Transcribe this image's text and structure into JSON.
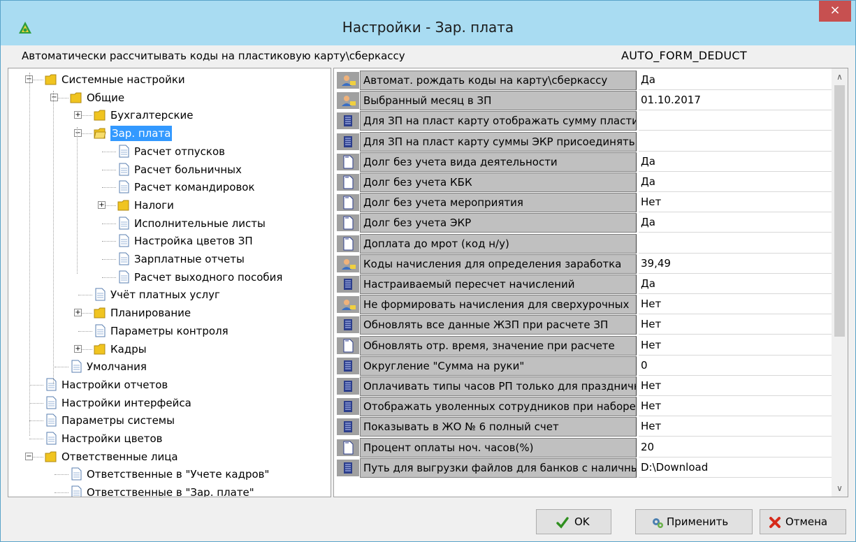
{
  "window": {
    "title": "Настройки - Зар. плата",
    "close": "×"
  },
  "description": {
    "text": "Автоматически рассчитывать коды на пластиковую карту\\сберкассу",
    "code": "AUTO_FORM_DEDUCT"
  },
  "tree": [
    {
      "label": "Системные настройки",
      "icon": "folder-icon"
    },
    {
      "label": "Общие",
      "icon": "folder-icon"
    },
    {
      "label": "Бухгалтерские",
      "icon": "folder-icon"
    },
    {
      "label": "Зар. плата",
      "icon": "folder-open-icon",
      "selected": true
    },
    {
      "label": "Расчет отпусков",
      "icon": "document-icon"
    },
    {
      "label": "Расчет больничных",
      "icon": "document-icon"
    },
    {
      "label": "Расчет командировок",
      "icon": "document-icon"
    },
    {
      "label": "Налоги",
      "icon": "folder-icon"
    },
    {
      "label": "Исполнительные листы",
      "icon": "document-icon"
    },
    {
      "label": "Настройка цветов ЗП",
      "icon": "document-icon"
    },
    {
      "label": "Зарплатные отчеты",
      "icon": "document-icon"
    },
    {
      "label": "Расчет выходного пособия",
      "icon": "document-icon"
    },
    {
      "label": "Учёт платных услуг",
      "icon": "document-icon"
    },
    {
      "label": "Планирование",
      "icon": "folder-icon"
    },
    {
      "label": "Параметры контроля",
      "icon": "document-icon"
    },
    {
      "label": "Кадры",
      "icon": "folder-icon"
    },
    {
      "label": "Умолчания",
      "icon": "document-icon"
    },
    {
      "label": "Настройки отчетов",
      "icon": "document-icon"
    },
    {
      "label": "Настройки интерфейса",
      "icon": "document-icon"
    },
    {
      "label": "Параметры системы",
      "icon": "document-icon"
    },
    {
      "label": "Настройки цветов",
      "icon": "document-icon"
    },
    {
      "label": "Ответственные лица",
      "icon": "folder-icon"
    },
    {
      "label": "Ответственные в \"Учете кадров\"",
      "icon": "document-icon"
    },
    {
      "label": "Ответственные в \"Зар. плате\"",
      "icon": "document-icon"
    }
  ],
  "settings": [
    {
      "icon": "user-icon",
      "name": "Автомат. рождать коды на карту\\сберкассу",
      "value": "Да"
    },
    {
      "icon": "user-icon",
      "name": "Выбранный месяц в ЗП",
      "value": "01.10.2017"
    },
    {
      "icon": "database-icon",
      "name": "Для ЗП на пласт карту отображать сумму пластиковой",
      "value": ""
    },
    {
      "icon": "database-icon",
      "name": "Для ЗП на пласт карту суммы ЭКР присоединять",
      "value": ""
    },
    {
      "icon": "page-icon",
      "name": "Долг без учета вида деятельности",
      "value": "Да"
    },
    {
      "icon": "page-icon",
      "name": "Долг без учета КБК",
      "value": "Да"
    },
    {
      "icon": "page-icon",
      "name": "Долг без учета мероприятия",
      "value": "Нет"
    },
    {
      "icon": "page-icon",
      "name": "Долг без учета ЭКР",
      "value": "Да"
    },
    {
      "icon": "page-icon",
      "name": "Доплата до мрот (код н/у)",
      "value": ""
    },
    {
      "icon": "user-icon",
      "name": "Коды начисления для определения заработка",
      "value": "39,49"
    },
    {
      "icon": "database-icon",
      "name": "Настраиваемый пересчет начислений",
      "value": "Да"
    },
    {
      "icon": "user-icon",
      "name": "Не формировать начисления для сверхурочных",
      "value": "Нет"
    },
    {
      "icon": "database-icon",
      "name": "Обновлять все данные ЖЗП при расчете ЗП",
      "value": "Нет"
    },
    {
      "icon": "page-icon",
      "name": "Обновлять отр. время, значение при расчете",
      "value": "Нет"
    },
    {
      "icon": "database-icon",
      "name": "Округление \"Сумма на руки\"",
      "value": "0"
    },
    {
      "icon": "database-icon",
      "name": "Оплачивать типы часов РП только для праздничных",
      "value": "Нет"
    },
    {
      "icon": "database-icon",
      "name": "Отображать уволенных сотрудников при наборе",
      "value": "Нет"
    },
    {
      "icon": "database-icon",
      "name": "Показывать в ЖО № 6 полный счет",
      "value": "Нет"
    },
    {
      "icon": "page-icon",
      "name": "Процент оплаты ноч. часов(%)",
      "value": "20"
    },
    {
      "icon": "database-icon",
      "name": "Путь для выгрузки файлов для банков с наличными",
      "value": "D:\\Download"
    }
  ],
  "buttons": {
    "ok": "OK",
    "apply": "Применить",
    "cancel": "Отмена"
  },
  "colors": {
    "titlebar": "#a9dcf2",
    "close": "#c75050",
    "selection": "#3399ff",
    "grid_name_bg": "#c0c0c0"
  }
}
